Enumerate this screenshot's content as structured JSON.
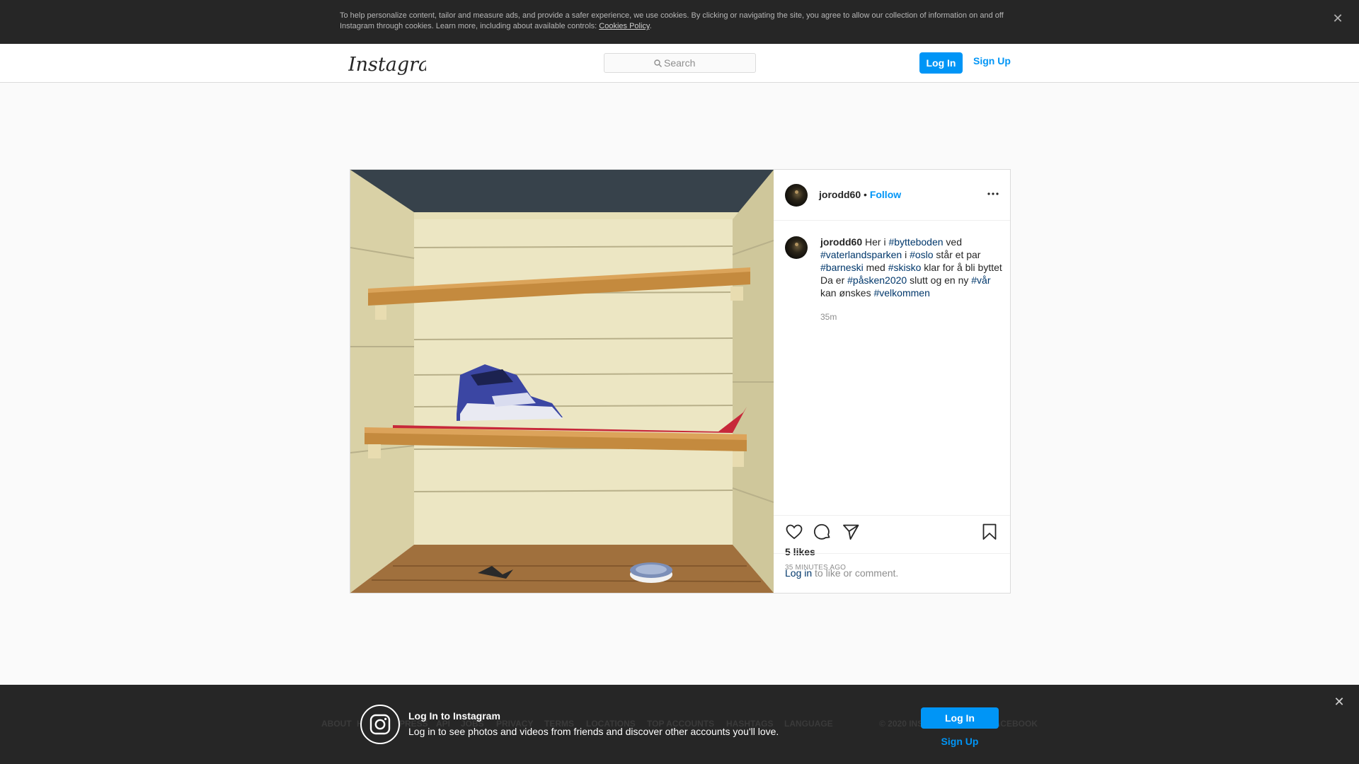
{
  "cookie_banner": {
    "text": "To help personalize content, tailor and measure ads, and provide a safer experience, we use cookies. By clicking or navigating the site, you agree to allow our collection of information on and off Instagram through cookies. Learn more, including about available controls: ",
    "link_label": "Cookies Policy",
    "close_icon": "close-icon"
  },
  "nav": {
    "logo_text": "Instagram",
    "search_placeholder": "Search",
    "login_label": "Log In",
    "signup_label": "Sign Up"
  },
  "post": {
    "username": "jorodd60",
    "separator": " • ",
    "follow_label": "Follow",
    "caption": {
      "username": "jorodd60",
      "parts": [
        {
          "t": " Her i ",
          "tag": false
        },
        {
          "t": "#bytteboden",
          "tag": true
        },
        {
          "t": " ved ",
          "tag": false
        },
        {
          "t": "#vaterlandsparken",
          "tag": true
        },
        {
          "t": " i ",
          "tag": false
        },
        {
          "t": "#oslo",
          "tag": true
        },
        {
          "t": " står et par ",
          "tag": false
        },
        {
          "t": "#barneski",
          "tag": true
        },
        {
          "t": " med ",
          "tag": false
        },
        {
          "t": "#skisko",
          "tag": true
        },
        {
          "t": " klar for å bli byttet⁣ Da er ",
          "tag": false
        },
        {
          "t": "#påsken2020",
          "tag": true
        },
        {
          "t": " slutt og en ny ",
          "tag": false
        },
        {
          "t": "#vår",
          "tag": true
        },
        {
          "t": " kan ønskes ",
          "tag": false
        },
        {
          "t": "#velkommen",
          "tag": true
        },
        {
          "t": " ⁣",
          "tag": false
        }
      ]
    },
    "time_short": "35m",
    "likes": "5 likes",
    "posted_ago": "35 MINUTES AGO",
    "comment_login": "Log in",
    "comment_rest": " to like or comment."
  },
  "bottom_bar": {
    "title": "Log In to Instagram",
    "subtitle": "Log in to see photos and videos from friends and discover other accounts you'll love.",
    "login_label": "Log In",
    "signup_label": "Sign Up",
    "footer_links": [
      "ABOUT",
      "HELP",
      "PRESS",
      "API",
      "JOBS",
      "PRIVACY",
      "TERMS",
      "LOCATIONS",
      "TOP ACCOUNTS",
      "HASHTAGS",
      "LANGUAGE"
    ],
    "copyright": "© 2020 INSTAGRAM FROM FACEBOOK"
  },
  "colors": {
    "accent": "#0095f6",
    "hashtag": "#00376b",
    "banner_bg": "#262626"
  }
}
